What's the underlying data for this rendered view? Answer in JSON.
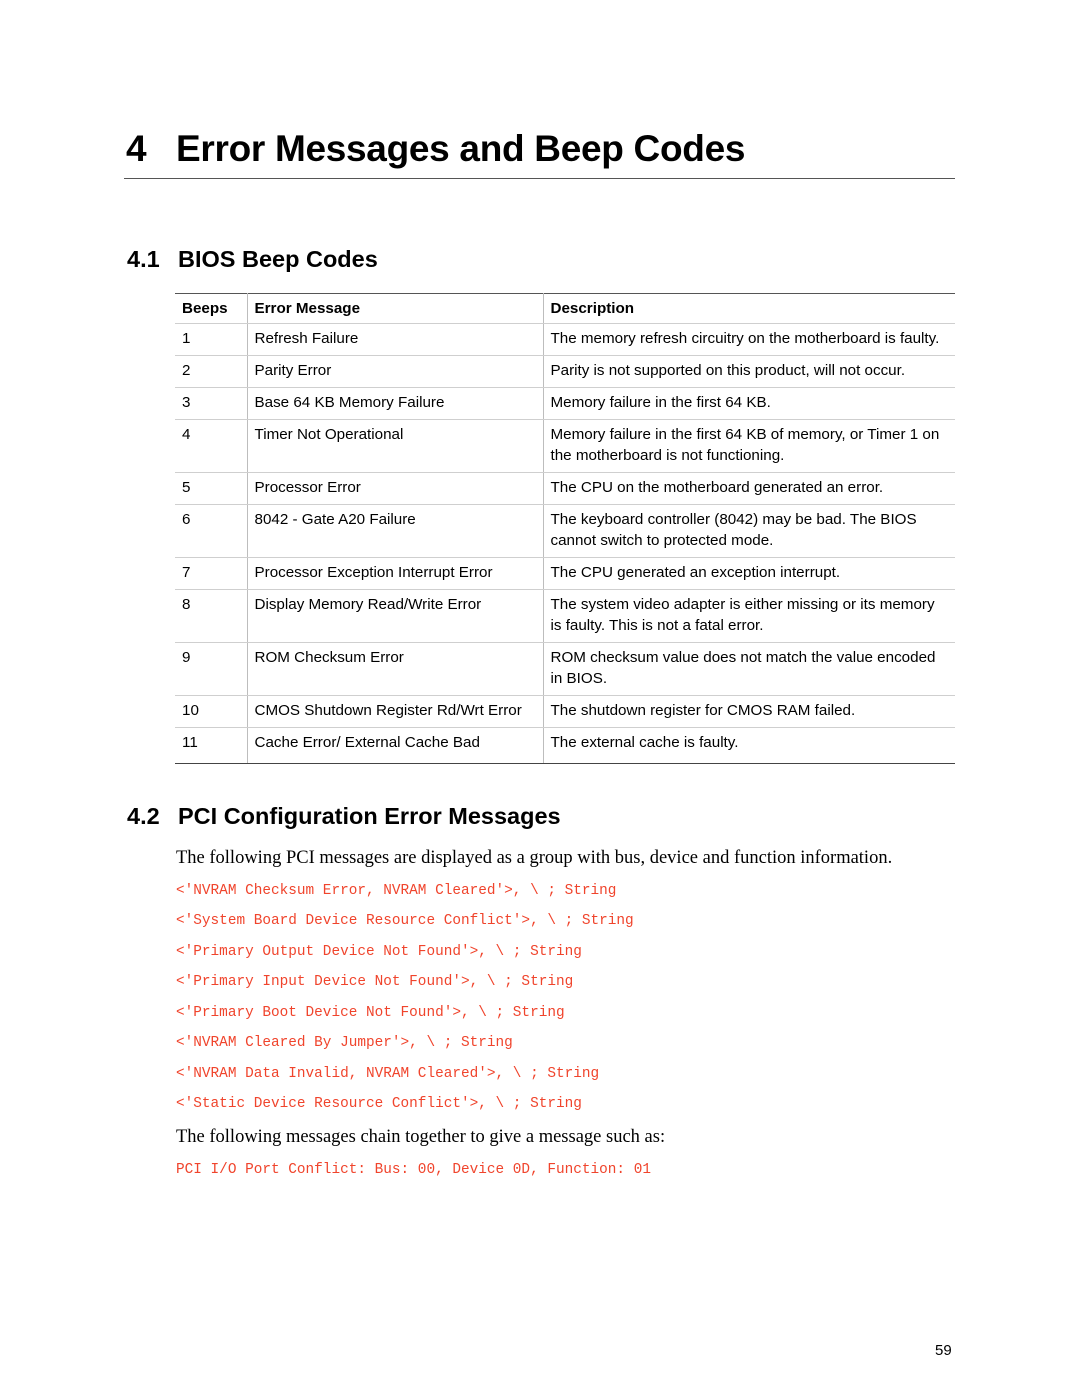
{
  "chapter": {
    "number": "4",
    "title": "Error Messages and Beep Codes"
  },
  "sections": [
    {
      "number": "4.1",
      "title": "BIOS Beep Codes"
    },
    {
      "number": "4.2",
      "title": "PCI Configuration Error Messages"
    }
  ],
  "beep_table": {
    "headers": [
      "Beeps",
      "Error Message",
      "Description"
    ],
    "rows": [
      {
        "beeps": "1",
        "message": "Refresh Failure",
        "description": "The memory refresh circuitry on the motherboard is faulty."
      },
      {
        "beeps": "2",
        "message": "Parity Error",
        "description": "Parity is not supported on this product, will not occur."
      },
      {
        "beeps": "3",
        "message": "Base 64 KB Memory Failure",
        "description": "Memory failure in the first 64 KB."
      },
      {
        "beeps": "4",
        "message": "Timer Not Operational",
        "description": "Memory failure in the first 64 KB of memory, or Timer 1 on the motherboard is not functioning."
      },
      {
        "beeps": "5",
        "message": "Processor Error",
        "description": "The CPU on the motherboard generated an error."
      },
      {
        "beeps": "6",
        "message": "8042 - Gate A20 Failure",
        "description": "The keyboard controller (8042) may be bad. The BIOS cannot switch to protected mode."
      },
      {
        "beeps": "7",
        "message": "Processor Exception Interrupt Error",
        "description": "The CPU generated an exception interrupt."
      },
      {
        "beeps": "8",
        "message": "Display Memory Read/Write Error",
        "description": "The system video adapter is either missing or its memory is faulty. This is not a fatal error."
      },
      {
        "beeps": "9",
        "message": "ROM Checksum Error",
        "description": "ROM checksum value does not match the value encoded in BIOS."
      },
      {
        "beeps": "10",
        "message": "CMOS Shutdown Register Rd/Wrt Error",
        "description": "The shutdown register for CMOS RAM failed."
      },
      {
        "beeps": "11",
        "message": "Cache Error/ External Cache Bad",
        "description": "The external cache is faulty."
      }
    ]
  },
  "pci": {
    "intro": "The following PCI messages are displayed as a group with bus, device and function information.",
    "messages": [
      "<'NVRAM Checksum Error, NVRAM Cleared'>, \\ ; String",
      "<'System Board Device Resource Conflict'>, \\ ; String",
      "<'Primary Output Device Not Found'>, \\ ; String",
      "<'Primary Input Device Not Found'>, \\ ; String",
      "<'Primary Boot Device Not Found'>, \\ ; String",
      "<'NVRAM Cleared By Jumper'>, \\ ; String",
      "<'NVRAM Data Invalid, NVRAM Cleared'>, \\ ; String",
      "<'Static Device Resource Conflict'>, \\ ; String"
    ],
    "chain_text": "The following messages chain together to give a message such as:",
    "example": "PCI I/O Port Conflict: Bus: 00, Device 0D, Function: 01"
  },
  "page_number": "59",
  "colors": {
    "code_text": "#f0442c"
  }
}
